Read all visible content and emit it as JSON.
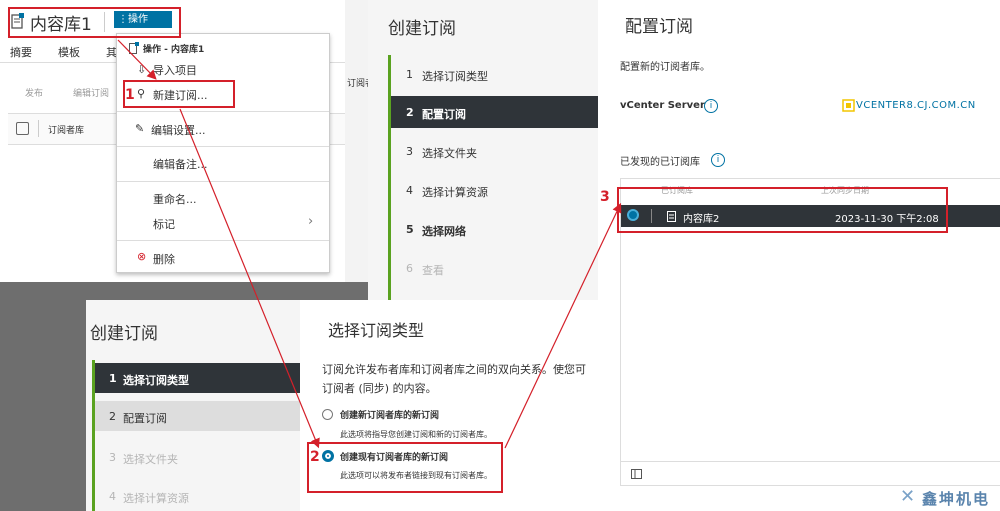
{
  "lib": {
    "title": "内容库1",
    "actions_label": "操作",
    "tabs": [
      "摘要",
      "模板",
      "其"
    ],
    "toolbar": [
      "发布",
      "编辑订阅"
    ],
    "col_header": "订阅者库",
    "behind_header": "订阅者"
  },
  "menu": {
    "header": "操作 - 内容库1",
    "items": [
      "导入项目",
      "新建订阅...",
      "编辑设置...",
      "编辑备注...",
      "重命名...",
      "标记",
      "删除"
    ]
  },
  "wiz_top": {
    "title": "创建订阅",
    "steps": [
      {
        "n": "1",
        "label": "选择订阅类型"
      },
      {
        "n": "2",
        "label": "配置订阅"
      },
      {
        "n": "3",
        "label": "选择文件夹"
      },
      {
        "n": "4",
        "label": "选择计算资源"
      },
      {
        "n": "5",
        "label": "选择网络"
      },
      {
        "n": "6",
        "label": "查看"
      }
    ]
  },
  "config": {
    "title": "配置订阅",
    "desc": "配置新的订阅者库。",
    "vcenter_label": "vCenter Server",
    "vcenter_value": "VCENTER8.CJ.COM.CN",
    "discovered_label": "已发现的已订阅库",
    "table_headers": [
      "已订阅库",
      "上次同步日期"
    ],
    "row": {
      "name": "内容库2",
      "date": "2023-11-30 下午2:08"
    }
  },
  "wiz_bottom": {
    "title": "创建订阅",
    "steps": [
      {
        "n": "1",
        "label": "选择订阅类型"
      },
      {
        "n": "2",
        "label": "配置订阅"
      },
      {
        "n": "3",
        "label": "选择文件夹"
      },
      {
        "n": "4",
        "label": "选择计算资源"
      }
    ]
  },
  "select_type": {
    "title": "选择订阅类型",
    "desc1": "订阅允许发布者库和订阅者库之间的双向关系。使您可",
    "desc2": "订阅者 (同步) 的内容。",
    "option1_title": "创建新订阅者库的新订阅",
    "option1_desc": "此选项将指导您创建订阅和新的订阅者库。",
    "option2_title": "创建现有订阅者库的新订阅",
    "option2_desc": "此选项可以将发布者链接到现有订阅者库。"
  },
  "markers": [
    "1",
    "2",
    "3"
  ],
  "watermark": "鑫坤机电",
  "colors": {
    "accent": "#0072a3",
    "highlight": "#d4202a",
    "nav_active": "#2f3439",
    "nav_bar": "#5aa220",
    "vcenter_icon": "#f2c500"
  }
}
